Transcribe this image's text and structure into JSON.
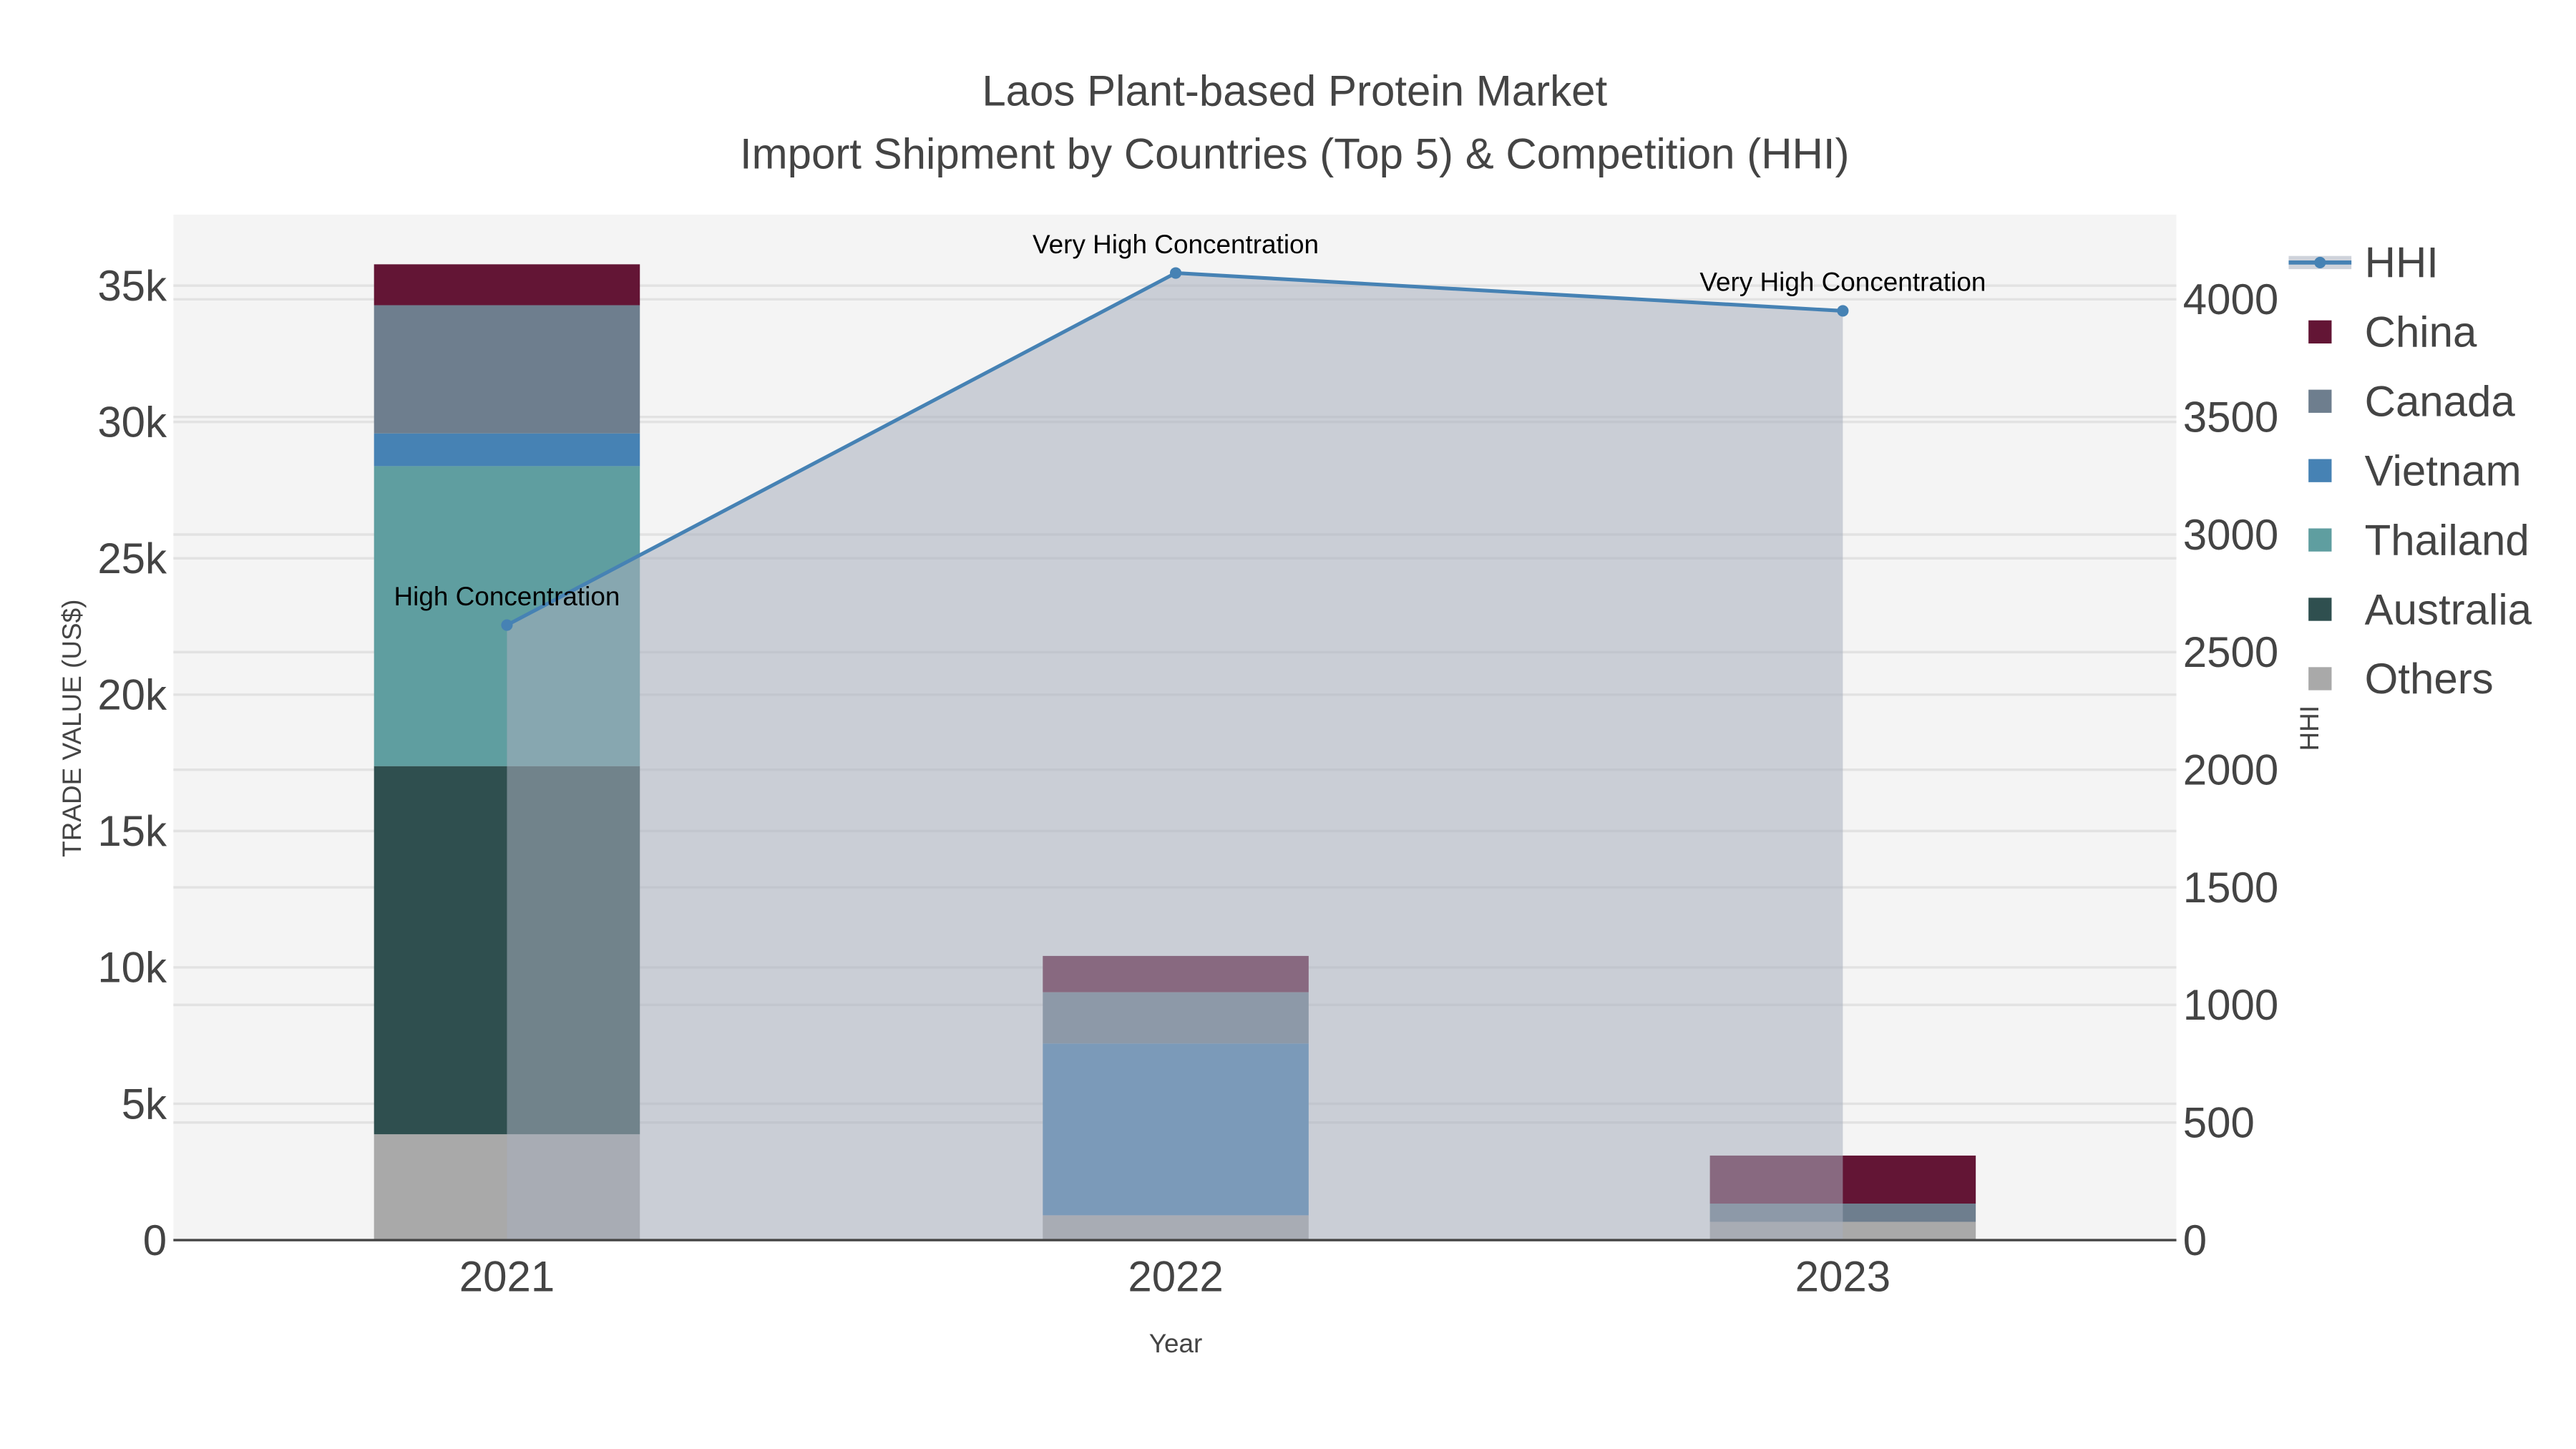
{
  "chart_data": {
    "type": "bar",
    "title": "Laos Plant-based Protein Market",
    "subtitle": "Import Shipment by Countries (Top 5) & Competition (HHI)",
    "xlabel": "Year",
    "ylabel": "TRADE VALUE (US$)",
    "y2label": "HHI",
    "categories": [
      "2021",
      "2022",
      "2023"
    ],
    "ylim": [
      0,
      37600
    ],
    "y2lim": [
      0,
      4360
    ],
    "yticks": [
      0,
      5000,
      10000,
      15000,
      20000,
      25000,
      30000,
      35000
    ],
    "ytick_labels": [
      "0",
      "5k",
      "10k",
      "15k",
      "20k",
      "25k",
      "30k",
      "35k"
    ],
    "y2ticks": [
      0,
      500,
      1000,
      1500,
      2000,
      2500,
      3000,
      3500,
      4000
    ],
    "y2tick_labels": [
      "0",
      "500",
      "1000",
      "1500",
      "2000",
      "2500",
      "3000",
      "3500",
      "4000"
    ],
    "legend_position": "right",
    "grid": true,
    "series": [
      {
        "name": "Others",
        "color": "#a9a9a9",
        "values": [
          3880,
          910,
          670
        ]
      },
      {
        "name": "Australia",
        "color": "#2f4f4f",
        "values": [
          13500,
          0,
          0
        ]
      },
      {
        "name": "Thailand",
        "color": "#5f9ea0",
        "values": [
          11000,
          0,
          0
        ]
      },
      {
        "name": "Vietnam",
        "color": "#4682b4",
        "values": [
          1200,
          6300,
          0
        ]
      },
      {
        "name": "Canada",
        "color": "#6e7e8e",
        "values": [
          4700,
          1880,
          670
        ]
      },
      {
        "name": "China",
        "color": "#631535",
        "values": [
          1500,
          1330,
          1760
        ]
      }
    ],
    "line": {
      "name": "HHI",
      "color": "#4682b4",
      "axis": "y2",
      "values": [
        2615,
        4112,
        3951
      ],
      "labels": [
        "High Concentration",
        "Very High Concentration",
        "Very High Concentration"
      ]
    },
    "legend_order": [
      "HHI",
      "China",
      "Canada",
      "Vietnam",
      "Thailand",
      "Australia",
      "Others"
    ]
  }
}
